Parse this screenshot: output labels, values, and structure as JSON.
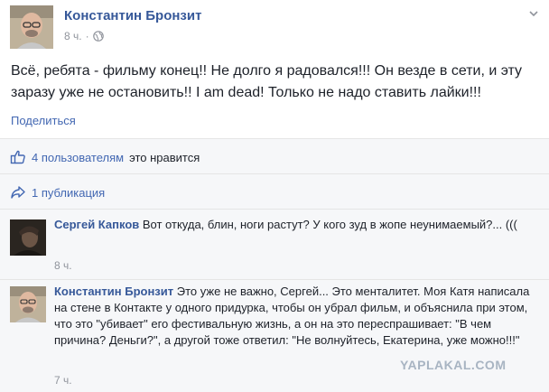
{
  "post": {
    "author": "Константин Бронзит",
    "time": "8 ч.",
    "text": "Всё, ребята - фильму конец!! Не долго я радовался!!! Он везде в сети, и эту заразу уже не остановить!! I am dead! Только не надо ставить лайки!!!",
    "share_label": "Поделиться"
  },
  "likes": {
    "count_label": "4 пользователям",
    "suffix": "это нравится"
  },
  "shares": {
    "label": "1 публикация"
  },
  "comments": [
    {
      "author": "Сергей Капков",
      "text": "Вот откуда, блин, ноги растут? У кого зуд в жопе неунимаемый?... (((",
      "time": "8 ч."
    },
    {
      "author": "Константин Бронзит",
      "text": "Это уже не важно, Сергей... Это менталитет. Моя Катя написала на стене в Контакте у одного придурка, чтобы он убрал фильм, и объяснила при этом, что это \"убивает\" его фестивальную жизнь, а он на это переспрашивает: \"В чем причина? Деньги?\", а другой тоже ответил: \"Не волнуйтесь, Екатерина, уже можно!!!\"",
      "time": "7 ч."
    }
  ],
  "watermark": "YAPLAKAL.COM",
  "colors": {
    "link": "#365899",
    "accent": "#4267b2",
    "meta": "#90949c",
    "feedback_bg": "#f6f7f9"
  }
}
